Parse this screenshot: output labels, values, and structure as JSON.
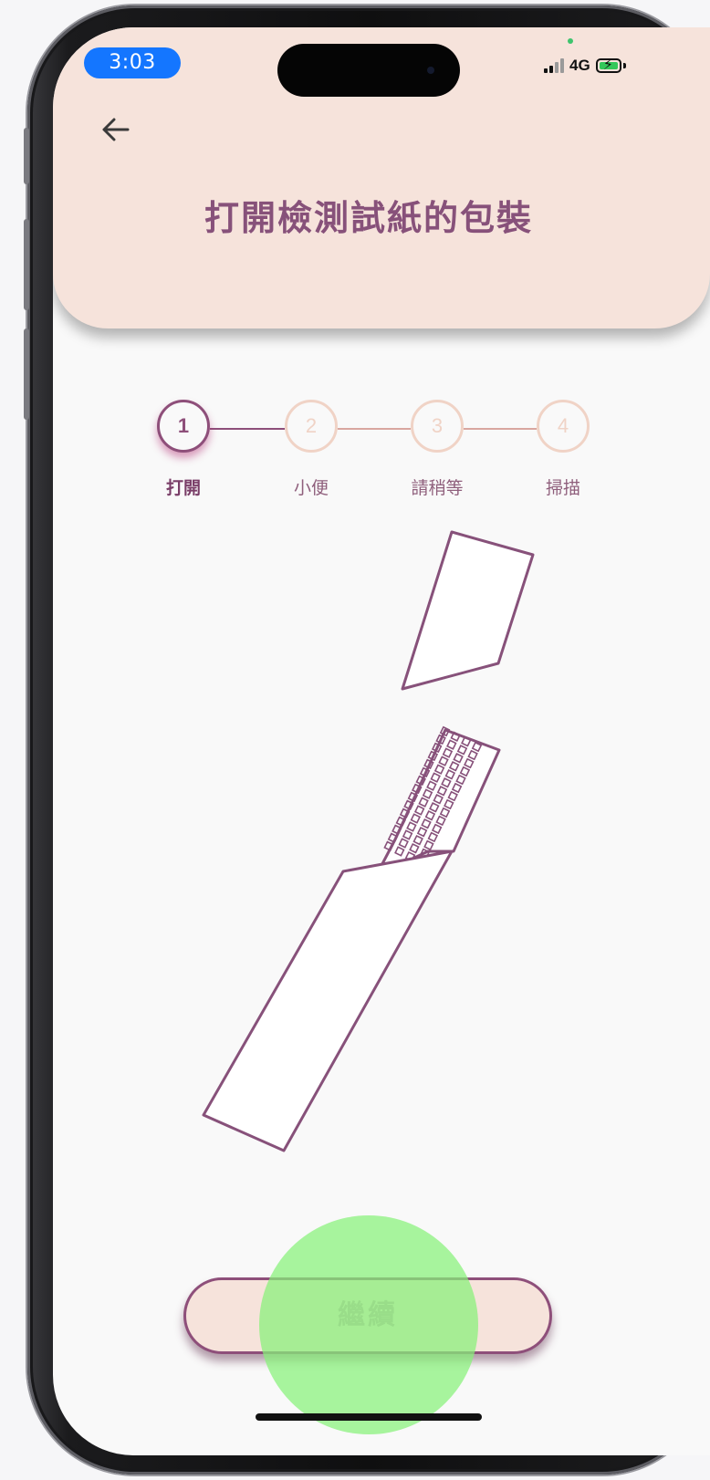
{
  "status_bar": {
    "time": "3:03",
    "network": "4G",
    "signal_icon": "cellular-signal-icon",
    "battery_icon": "battery-charging-icon",
    "battery_color": "#34c759",
    "time_pill_color": "#1476ff"
  },
  "header": {
    "back_icon": "arrow-left-icon",
    "title": "打開檢測試紙的包裝",
    "background": "#f6e3db",
    "title_color": "#87517a"
  },
  "stepper": {
    "current_step": 1,
    "steps": [
      {
        "number": "1",
        "label": "打開"
      },
      {
        "number": "2",
        "label": "小便"
      },
      {
        "number": "3",
        "label": "請稍等"
      },
      {
        "number": "4",
        "label": "掃描"
      }
    ],
    "active_color": "#8e4f7a",
    "inactive_color": "#f0d3c6"
  },
  "illustration": {
    "icon": "opened-test-strip-package-illustration",
    "stroke_color": "#87517a"
  },
  "footer": {
    "continue_label": "繼續"
  },
  "touch_indicator": {
    "color": "#86f178"
  }
}
